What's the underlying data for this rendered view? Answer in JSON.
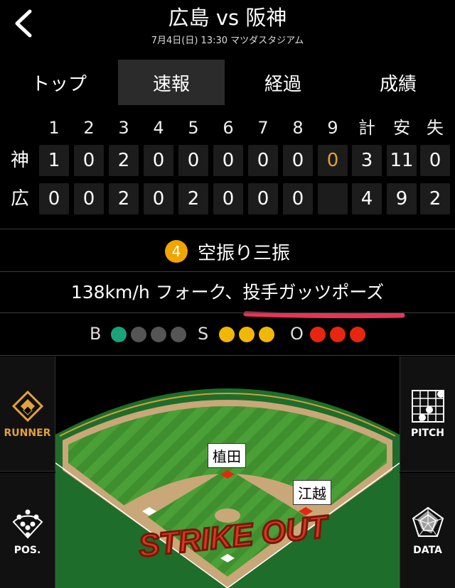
{
  "header": {
    "title": "広島 vs 阪神",
    "subtitle": "7月4日(日) 13:30 マツダスタジアム"
  },
  "tabs": [
    {
      "label": "トップ",
      "active": false
    },
    {
      "label": "速報",
      "active": true
    },
    {
      "label": "経過",
      "active": false
    },
    {
      "label": "成績",
      "active": false
    }
  ],
  "scoreboard": {
    "headers": [
      "1",
      "2",
      "3",
      "4",
      "5",
      "6",
      "7",
      "8",
      "9",
      "計",
      "安",
      "失"
    ],
    "rows": [
      {
        "team": "神",
        "cells": [
          "1",
          "0",
          "2",
          "0",
          "0",
          "0",
          "0",
          "0",
          "0",
          "3",
          "11",
          "0"
        ]
      },
      {
        "team": "広",
        "cells": [
          "0",
          "0",
          "2",
          "0",
          "2",
          "0",
          "0",
          "0",
          "",
          "4",
          "9",
          "2"
        ]
      }
    ]
  },
  "play": {
    "number": "4",
    "result": "空振り三振",
    "description": "138km/h フォーク、投手ガッツポーズ"
  },
  "count": {
    "b_label": "B",
    "s_label": "S",
    "o_label": "O",
    "balls": 1,
    "strikes": 3,
    "outs": 3,
    "ball_color": "#1aa37a",
    "strike_color": "#f2b705",
    "out_color": "#e8260f",
    "empty_color": "#555555"
  },
  "field": {
    "players": [
      "植田",
      "江越"
    ],
    "overlay": "STRIKE OUT"
  },
  "side_buttons": {
    "runner": "RUNNER",
    "pos": "POS.",
    "pitch": "PITCH",
    "data": "DATA"
  }
}
